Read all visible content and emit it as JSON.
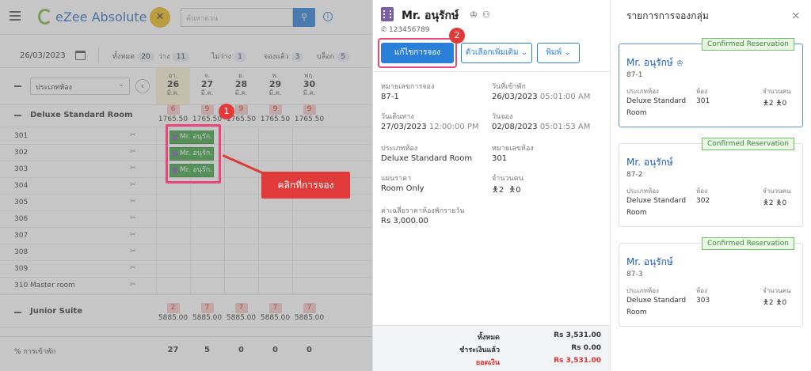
{
  "app": {
    "logo_text": "eZee Absolute",
    "search_placeholder": "ค้นหาด่วน"
  },
  "filters": {
    "date": "26/03/2023",
    "all_label": "ทั้งหมด",
    "all_count": "20",
    "vacant_label": "ว่าง",
    "vacant_count": "11",
    "occupied_label": "ไม่ว่าง",
    "occupied_count": "1",
    "reserved_label": "จองแล้ว",
    "reserved_count": "3",
    "blocked_label": "บล็อก",
    "blocked_count": "5"
  },
  "grid": {
    "room_type_select": "ประเภทห้อง",
    "days": [
      {
        "dow": "อา.",
        "day": "26",
        "mon": "มี.ค."
      },
      {
        "dow": "จ.",
        "day": "27",
        "mon": "มี.ค."
      },
      {
        "dow": "อ.",
        "day": "28",
        "mon": "มี.ค."
      },
      {
        "dow": "พ.",
        "day": "29",
        "mon": "มี.ค."
      },
      {
        "dow": "พฤ.",
        "day": "30",
        "mon": "มี.ค."
      }
    ],
    "group1": {
      "name": "Deluxe Standard Room",
      "avail": [
        "6",
        "9",
        "9",
        "9",
        "9"
      ],
      "rates": [
        "1765.50",
        "1765.50",
        "1765.50",
        "1765.50",
        "1765.50"
      ]
    },
    "rooms": [
      "301",
      "302",
      "303",
      "304",
      "305",
      "306",
      "307",
      "308",
      "309",
      "310 Master room"
    ],
    "reservation_label": "Mr. อนุรัก...",
    "group2": {
      "name": "Junior Suite",
      "avail": [
        "2",
        "7",
        "7",
        "7",
        "7"
      ],
      "rates": [
        "5885.00",
        "5885.00",
        "5885.00",
        "5885.00",
        "5885.00"
      ]
    },
    "occupancy_label": "% การเข้าพัก",
    "occupancy": [
      "27",
      "5",
      "0",
      "0",
      "0"
    ]
  },
  "annotation": {
    "step1": "1",
    "step2": "2",
    "callout": "คลิกที่การจอง"
  },
  "detail": {
    "guest_name": "Mr. อนุรักษ์",
    "phone": "123456789",
    "edit_button": "แก้ไขการจอง",
    "more_options": "ตัวเลือกเพิ่มเติม",
    "print": "พิมพ์",
    "res_no_label": "หมายเลขการจอง",
    "res_no": "87-1",
    "checkin_label": "วันที่เข้าพัก",
    "checkin_date": "26/03/2023",
    "checkin_time": "05:01:00 AM",
    "departure_label": "วันเดินทาง",
    "departure_date": "27/03/2023",
    "departure_time": "12:00:00 PM",
    "booking_label": "วันจอง",
    "booking_date": "02/08/2023",
    "booking_time": "05:01:53 AM",
    "room_type_label": "ประเภทห้อง",
    "room_type": "Deluxe Standard Room",
    "room_no_label": "หมายเลขห้อง",
    "room_no": "301",
    "rate_plan_label": "แผนราคา",
    "rate_plan": "Room Only",
    "pax_label": "จำนวนคน",
    "adults": "2",
    "children": "0",
    "avg_rate_label": "ค่าเฉลี่ยราคาห้องพักรายวัน",
    "avg_rate": "Rs 3,000.00",
    "total_label": "ทั้งหมด",
    "total": "Rs 3,531.00",
    "paid_label": "ชำระเงินแล้ว",
    "paid": "Rs 0.00",
    "balance_label": "ยอดเงิน",
    "balance": "Rs 3,531.00"
  },
  "group": {
    "title": "รายการการจองกลุ่ม",
    "status": "Confirmed Reservation",
    "col_room_type": "ประเภทห้อง",
    "col_room": "ห้อง",
    "col_pax": "จำนวนคน",
    "cards": [
      {
        "name": "Mr. อนุรักษ์",
        "num": "87-1",
        "type1": "Deluxe Standard",
        "type2": "Room",
        "room": "301",
        "adults": "2",
        "children": "0"
      },
      {
        "name": "Mr. อนุรักษ์",
        "num": "87-2",
        "type1": "Deluxe Standard",
        "type2": "Room",
        "room": "302",
        "adults": "2",
        "children": "0"
      },
      {
        "name": "Mr. อนุรักษ์",
        "num": "87-3",
        "type1": "Deluxe Standard",
        "type2": "Room",
        "room": "303",
        "adults": "2",
        "children": "0"
      }
    ]
  }
}
